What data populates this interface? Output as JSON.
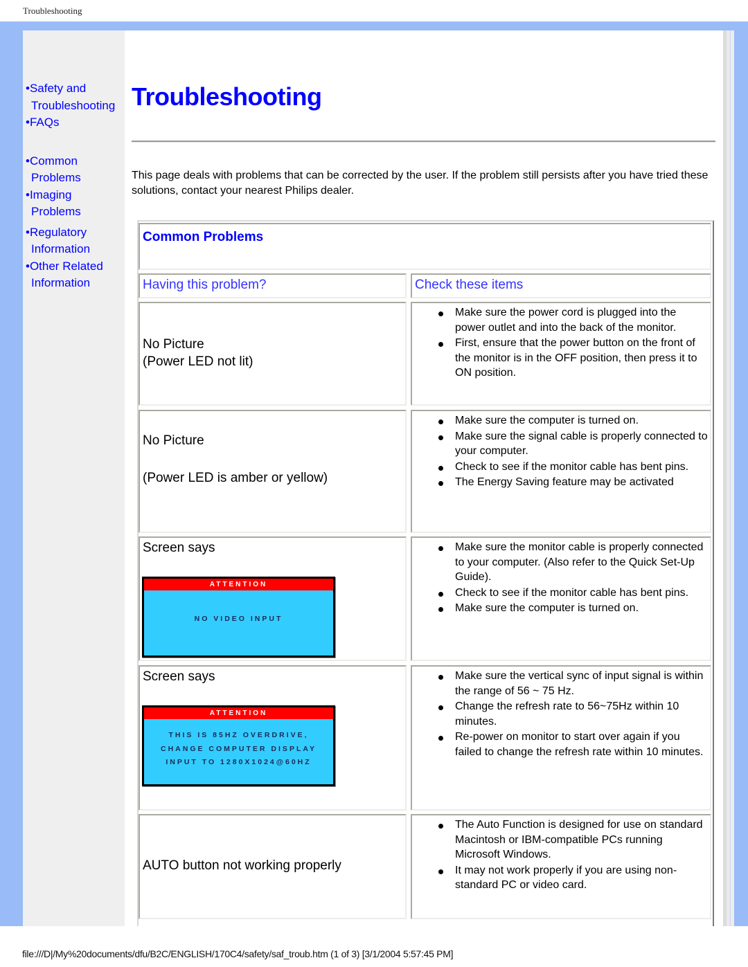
{
  "page_header": "Troubleshooting",
  "sidebar": {
    "groups": [
      {
        "items": [
          {
            "label": "•Safety and",
            "cont": "Troubleshooting"
          },
          {
            "label": "•FAQs"
          }
        ]
      },
      {
        "items": [
          {
            "label": "•Common",
            "cont": "Problems"
          },
          {
            "label": "•Imaging",
            "cont": "Problems"
          }
        ]
      },
      {
        "items": [
          {
            "label": "•Regulatory",
            "cont": "Information"
          },
          {
            "label": "•Other Related",
            "cont": "Information"
          }
        ]
      }
    ]
  },
  "main": {
    "title": "Troubleshooting",
    "intro": "This page deals with problems that can be corrected by the user. If the problem still persists after you have tried these solutions, contact your nearest Philips dealer.",
    "section_title": "Common Problems",
    "col_headers": {
      "problem": "Having this problem?",
      "check": "Check these items"
    },
    "rows": [
      {
        "problem_lines": [
          "No Picture",
          "(Power LED not lit)"
        ],
        "checks": [
          "Make sure the power cord is plugged into the power outlet and into the back of the monitor.",
          "First, ensure that the power button on the front of the monitor is in the OFF position, then press it to ON position."
        ]
      },
      {
        "problem_lines": [
          "No Picture",
          "(Power LED is amber or yellow)"
        ],
        "checks": [
          "Make sure the computer is turned on.",
          "Make sure the signal cable is properly connected to your computer.",
          "Check to see if the monitor cable has bent pins.",
          "The Energy Saving feature may be activated"
        ]
      },
      {
        "problem_lines": [
          "Screen says"
        ],
        "osd": {
          "header": "ATTENTION",
          "message": [
            "NO VIDEO INPUT"
          ]
        },
        "checks": [
          "Make sure the monitor cable is properly connected to your computer. (Also refer to the Quick Set-Up Guide).",
          "Check to see if the monitor cable has bent pins.",
          "Make sure the computer is turned on."
        ]
      },
      {
        "problem_lines": [
          "Screen says"
        ],
        "osd": {
          "header": "ATTENTION",
          "message": [
            "THIS IS 85HZ OVERDRIVE,",
            "CHANGE COMPUTER DISPLAY",
            "INPUT TO 1280X1024@60HZ"
          ]
        },
        "checks": [
          "Make sure the vertical sync of input signal is within the range of 56 ~ 75 Hz.",
          "Change the refresh rate to 56~75Hz within 10 minutes.",
          "Re-power on monitor to start over again if you failed to change the refresh rate within 10 minutes."
        ]
      },
      {
        "problem_lines": [
          "AUTO button not working properly"
        ],
        "checks": [
          "The Auto Function is designed for use on standard Macintosh or IBM-compatible PCs running Microsoft Windows.",
          "It may not work properly if you are using non-standard PC or video card."
        ]
      }
    ]
  },
  "footer": "file:///D|/My%20documents/dfu/B2C/ENGLISH/170C4/safety/saf_troub.htm (1 of 3) [3/1/2004 5:57:45 PM]",
  "colors": {
    "frame": "#99bbf7",
    "link": "#0000ff",
    "osd_bar": "#ff0000",
    "osd_bg": "#33ccff"
  }
}
